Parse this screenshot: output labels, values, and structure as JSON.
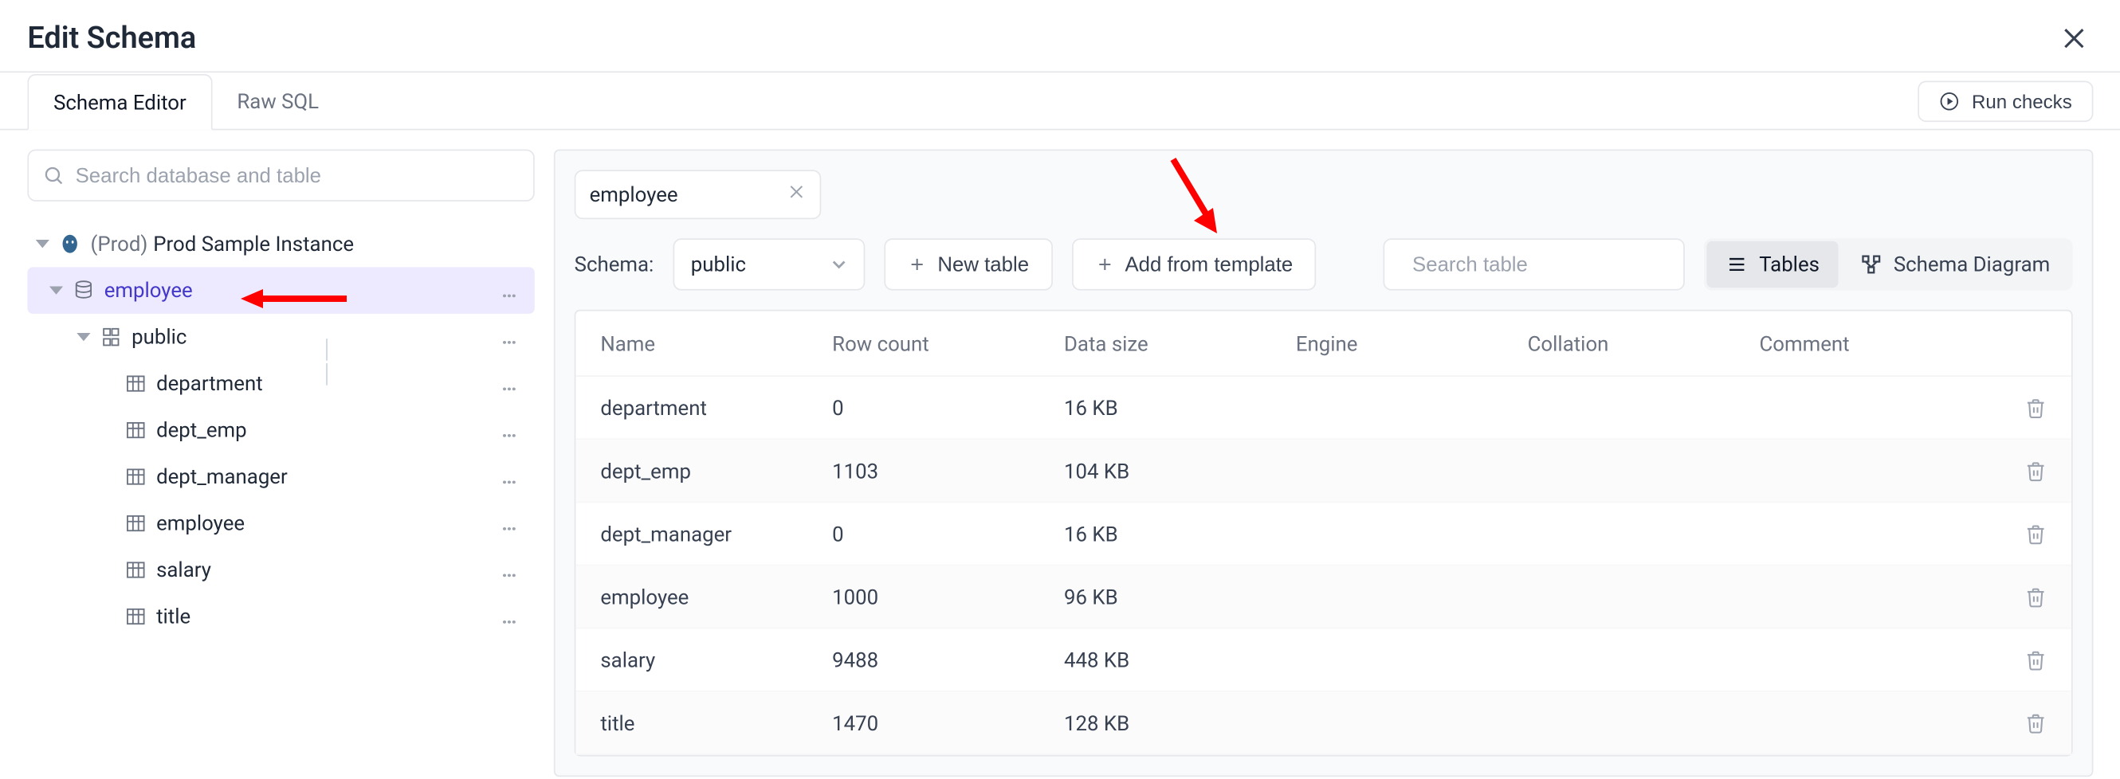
{
  "header": {
    "title": "Edit Schema"
  },
  "tabs": {
    "items": [
      {
        "label": "Schema Editor",
        "active": true
      },
      {
        "label": "Raw SQL",
        "active": false
      }
    ],
    "run_checks_label": "Run checks"
  },
  "sidebar": {
    "search_placeholder": "Search database and table",
    "tree": {
      "instance_env": "(Prod)",
      "instance_name": "Prod Sample Instance",
      "database": "employee",
      "schema": "public",
      "tables": [
        "department",
        "dept_emp",
        "dept_manager",
        "employee",
        "salary",
        "title"
      ]
    }
  },
  "panel": {
    "db_filter_value": "employee",
    "schema_label": "Schema:",
    "schema_value": "public",
    "new_table_label": "New table",
    "add_template_label": "Add from template",
    "table_search_placeholder": "Search table",
    "view_tables_label": "Tables",
    "view_diagram_label": "Schema Diagram",
    "columns": [
      "Name",
      "Row count",
      "Data size",
      "Engine",
      "Collation",
      "Comment"
    ],
    "rows": [
      {
        "name": "department",
        "row_count": "0",
        "data_size": "16 KB",
        "engine": "",
        "collation": "",
        "comment": ""
      },
      {
        "name": "dept_emp",
        "row_count": "1103",
        "data_size": "104 KB",
        "engine": "",
        "collation": "",
        "comment": ""
      },
      {
        "name": "dept_manager",
        "row_count": "0",
        "data_size": "16 KB",
        "engine": "",
        "collation": "",
        "comment": ""
      },
      {
        "name": "employee",
        "row_count": "1000",
        "data_size": "96 KB",
        "engine": "",
        "collation": "",
        "comment": ""
      },
      {
        "name": "salary",
        "row_count": "9488",
        "data_size": "448 KB",
        "engine": "",
        "collation": "",
        "comment": ""
      },
      {
        "name": "title",
        "row_count": "1470",
        "data_size": "128 KB",
        "engine": "",
        "collation": "",
        "comment": ""
      }
    ]
  },
  "icons": {
    "more": "…"
  }
}
